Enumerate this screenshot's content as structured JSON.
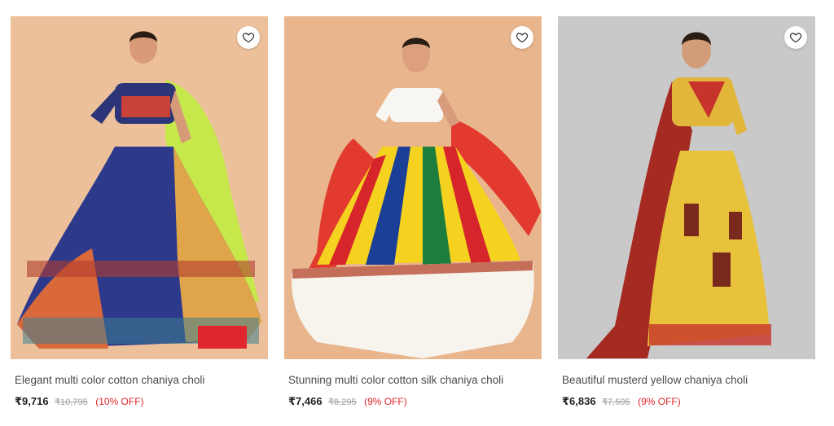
{
  "products": [
    {
      "title": "Elegant multi color cotton chaniya choli",
      "price": "₹9,716",
      "mrp": "₹10,795",
      "discount": "(10% OFF)",
      "image_icon": "product-photo-lehenga-multicolor",
      "wishlist_icon": "heart-outline-icon"
    },
    {
      "title": "Stunning multi color cotton silk chaniya choli",
      "price": "₹7,466",
      "mrp": "₹8,295",
      "discount": "(9% OFF)",
      "image_icon": "product-photo-lehenga-striped",
      "wishlist_icon": "heart-outline-icon"
    },
    {
      "title": "Beautiful musterd yellow chaniya choli",
      "price": "₹6,836",
      "mrp": "₹7,595",
      "discount": "(9% OFF)",
      "image_icon": "product-photo-lehenga-yellow",
      "wishlist_icon": "heart-outline-icon"
    }
  ],
  "colors": {
    "title_text": "#4a4a4a",
    "price_text": "#222222",
    "mrp_text": "#a0a0a0",
    "discount_text": "#e0272b"
  }
}
